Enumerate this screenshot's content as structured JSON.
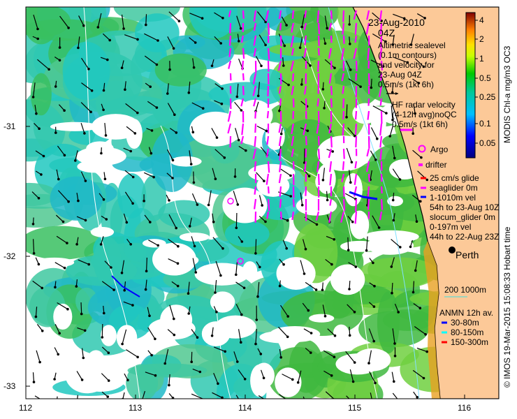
{
  "map": {
    "date": "23-Aug-2010",
    "time": "04Z",
    "altimetry_lines": [
      "Altimetric sealevel",
      "(0.1m contours)",
      "and velocity for",
      "23-Aug 04Z",
      "0.5m/s (1kt 6h)"
    ],
    "hf_lines": [
      "HF radar velocity",
      "(4-12h avg)noQC",
      "0.5m/s (1kt 6h)"
    ],
    "argo_label": "Argo",
    "drifter_label": "drifter",
    "glider_lines": [
      "25 cm/s glide",
      "seaglider 0m",
      "1-1010m vel",
      "54h to 23-Aug 10Z",
      "slocum_glider 0m",
      "0-197m vel",
      "44h to 22-Aug 23Z"
    ],
    "city": "Perth",
    "isobath_label": "200  1000m",
    "anmn_title": "ANMN 12h av.",
    "anmn_items": [
      {
        "label": "30-80m",
        "color": "#0000ff"
      },
      {
        "label": "80-150m",
        "color": "#00ffff"
      },
      {
        "label": "150-300m",
        "color": "#ff0000"
      }
    ],
    "colorbar_title": "MODIS Chl-a mg/m3 OC3",
    "colorbar_ticks": [
      "4",
      "2",
      "1",
      "0.5",
      "0.25",
      "0.1",
      "0.05"
    ],
    "credit": "© IMOS 19-Mar-2015 15:08:33 Hobart time",
    "x_ticks": [
      "112",
      "113",
      "114",
      "115",
      "116"
    ],
    "y_ticks": [
      "-31",
      "-32",
      "-33"
    ],
    "colors": {
      "land": "#fcc998",
      "hf_radar": "#ff00ff",
      "altimetry_arrows": "#000000",
      "contours": "#ffffff"
    }
  }
}
